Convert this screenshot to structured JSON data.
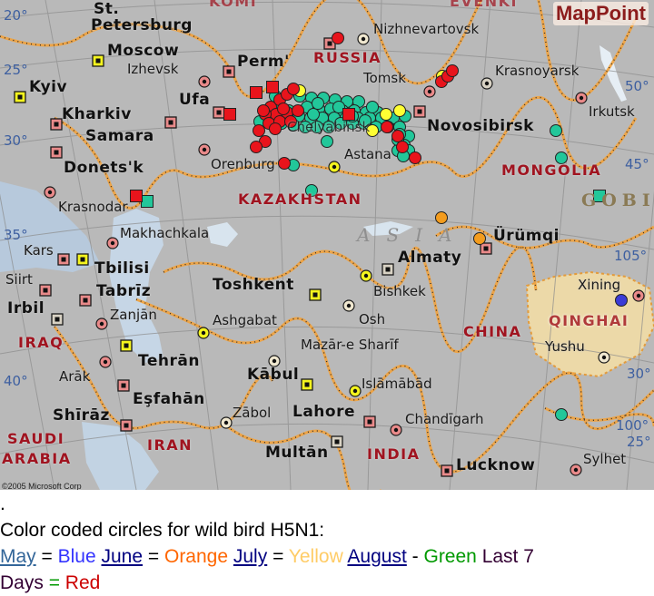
{
  "map": {
    "brand": "MapPoint",
    "copyright": "©2005 Microsoft Corp",
    "cities_major": [
      {
        "name": "St.",
        "id": "st"
      },
      {
        "name": "Petersburg",
        "id": "petersburg"
      },
      {
        "name": "Moscow",
        "id": "moscow"
      },
      {
        "name": "Perm'",
        "id": "perm"
      },
      {
        "name": "Kyiv",
        "id": "kyiv"
      },
      {
        "name": "Ufa",
        "id": "ufa"
      },
      {
        "name": "Kharkiv",
        "id": "kharkiv"
      },
      {
        "name": "Samara",
        "id": "samara"
      },
      {
        "name": "Donets'k",
        "id": "donetsk"
      },
      {
        "name": "Novosibirsk",
        "id": "novosibirsk"
      },
      {
        "name": "Ürümqi",
        "id": "urumqi"
      },
      {
        "name": "Tbilisi",
        "id": "tbilisi"
      },
      {
        "name": "Tabrīz",
        "id": "tabriz"
      },
      {
        "name": "Irbil",
        "id": "irbil"
      },
      {
        "name": "Toshkent",
        "id": "toshkent"
      },
      {
        "name": "Almaty",
        "id": "almaty"
      },
      {
        "name": "Tehrān",
        "id": "tehran"
      },
      {
        "name": "Eşfahān",
        "id": "esfahan"
      },
      {
        "name": "Shīrāz",
        "id": "shiraz"
      },
      {
        "name": "Kābul",
        "id": "kabul"
      },
      {
        "name": "Lahore",
        "id": "lahore"
      },
      {
        "name": "Multān",
        "id": "multan"
      },
      {
        "name": "Lucknow",
        "id": "lucknow"
      }
    ],
    "cities_minor": [
      {
        "name": "Izhevsk"
      },
      {
        "name": "Nizhnevartovsk"
      },
      {
        "name": "Tomsk"
      },
      {
        "name": "Krasnoyarsk"
      },
      {
        "name": "Irkutsk"
      },
      {
        "name": "Orenburg"
      },
      {
        "name": "Astana"
      },
      {
        "name": "Krasnodar"
      },
      {
        "name": "Makhachkala"
      },
      {
        "name": "Kars"
      },
      {
        "name": "Siirt"
      },
      {
        "name": "Zanjān"
      },
      {
        "name": "Ashgabat"
      },
      {
        "name": "Bishkek"
      },
      {
        "name": "Osh"
      },
      {
        "name": "Mazār-e Sharīf"
      },
      {
        "name": "Xining"
      },
      {
        "name": "Yushu"
      },
      {
        "name": "Arāk"
      },
      {
        "name": "Islāmābād"
      },
      {
        "name": "Zābol"
      },
      {
        "name": "Chandīgarh"
      },
      {
        "name": "Sylhet"
      },
      {
        "name": "Chelyabinsk"
      }
    ],
    "countries": [
      "RUSSIA",
      "KAZAKHSTAN",
      "MONGOLIA",
      "CHINA",
      "QINGHAI",
      "IRAQ",
      "IRAN",
      "SAUDI",
      "ARABIA",
      "INDIA",
      "KOMI",
      "EVENKI"
    ],
    "regions": [
      "GOBI",
      "ASIA"
    ],
    "degree_labels": [
      "20°",
      "25°",
      "30°",
      "35°",
      "40°",
      "50°",
      "45°",
      "105°",
      "30°",
      "100°",
      "25°"
    ],
    "marker_colors": {
      "blue": "#3b3bd6",
      "orange": "#f39c1e",
      "yellow": "#ffff33",
      "green": "#22c79a",
      "red": "#e8141c"
    },
    "bird_markers": {
      "red": 34,
      "green": 60,
      "yellow": 7,
      "orange": 3,
      "blue": 1
    }
  },
  "caption": {
    "dot": ".",
    "title": "Color coded circles for wild bird H5N1:",
    "legend": [
      {
        "month": "May",
        "sep": " = ",
        "color_name": "Blue"
      },
      {
        "month": "June",
        "sep": " = ",
        "color_name": "Orange"
      },
      {
        "month": "July",
        "sep": " = ",
        "color_name": "Yellow"
      },
      {
        "month": "August",
        "sep": " - ",
        "color_name": "Green"
      }
    ],
    "last_label_1": "Last 7",
    "last_label_2": "Days",
    "last_sep": " = ",
    "last_color_name": "Red"
  }
}
